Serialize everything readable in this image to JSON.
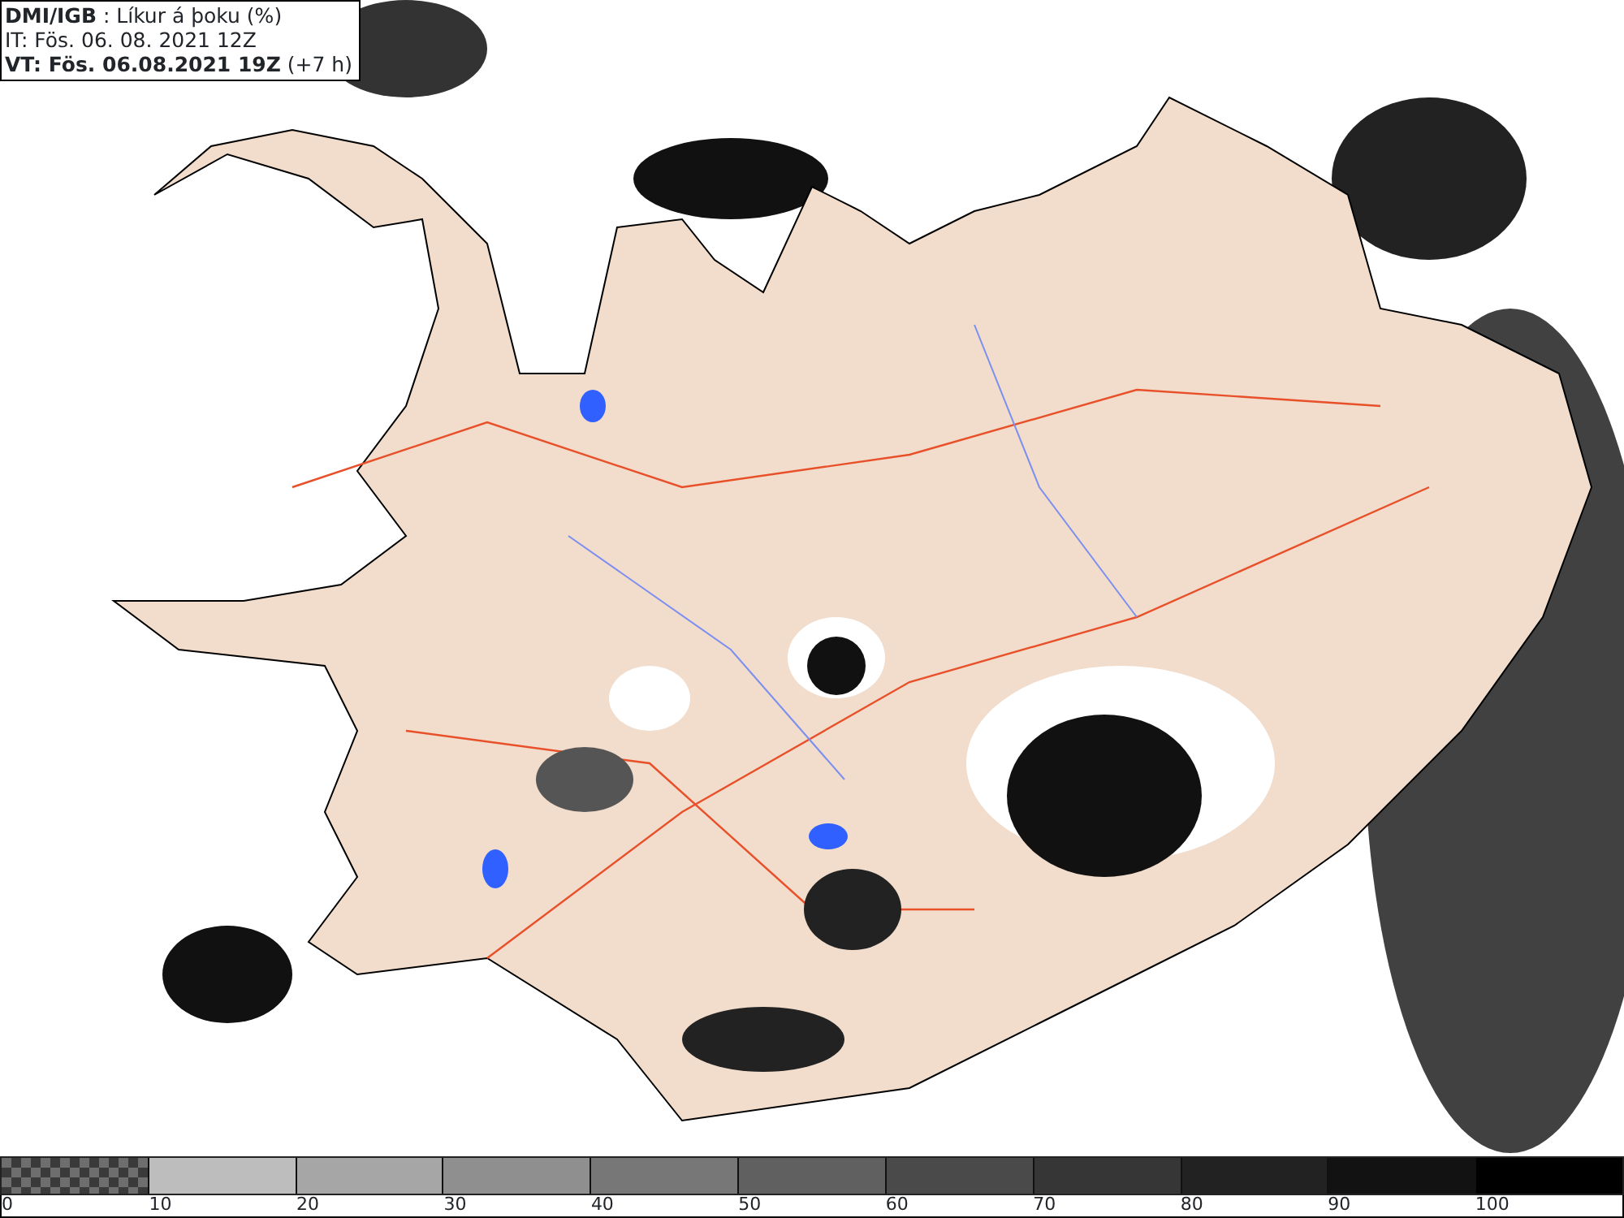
{
  "title_box": {
    "lines": [
      "**DMI/IGB** : Líkur á þoku (%)",
      "IT: Fös. 06. 08. 2021 12Z",
      "**VT: Fös. 06.08.2021 19Z** (+7 h)"
    ]
  },
  "legend": [
    {
      "label": "0",
      "kind": "checker",
      "color": "#6e6e6e"
    },
    {
      "label": "10",
      "kind": "solid",
      "color": "#bdbdbd"
    },
    {
      "label": "20",
      "kind": "solid",
      "color": "#a6a6a6"
    },
    {
      "label": "30",
      "kind": "solid",
      "color": "#8f8f8f"
    },
    {
      "label": "40",
      "kind": "solid",
      "color": "#777777"
    },
    {
      "label": "50",
      "kind": "solid",
      "color": "#606060"
    },
    {
      "label": "60",
      "kind": "solid",
      "color": "#4a4a4a"
    },
    {
      "label": "70",
      "kind": "solid",
      "color": "#363636"
    },
    {
      "label": "80",
      "kind": "solid",
      "color": "#222222"
    },
    {
      "label": "90",
      "kind": "solid",
      "color": "#121212"
    },
    {
      "label": "100",
      "kind": "solid",
      "color": "#000000"
    }
  ]
}
